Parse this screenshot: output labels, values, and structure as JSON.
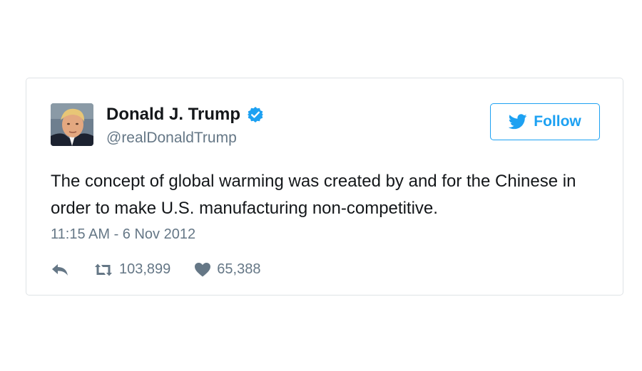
{
  "tweet": {
    "author_name": "Donald J. Trump",
    "handle": "@realDonaldTrump",
    "verified_icon": "verified-badge-icon",
    "follow_label": "Follow",
    "text": "The concept of global warming was created by and for the Chinese in order to make U.S. manufacturing non-competitive.",
    "timestamp": "11:15 AM - 6 Nov 2012",
    "retweets": "103,899",
    "likes": "65,388"
  },
  "colors": {
    "accent": "#1da1f2",
    "text": "#14171a",
    "muted": "#657786",
    "border": "#dfe3e6"
  }
}
